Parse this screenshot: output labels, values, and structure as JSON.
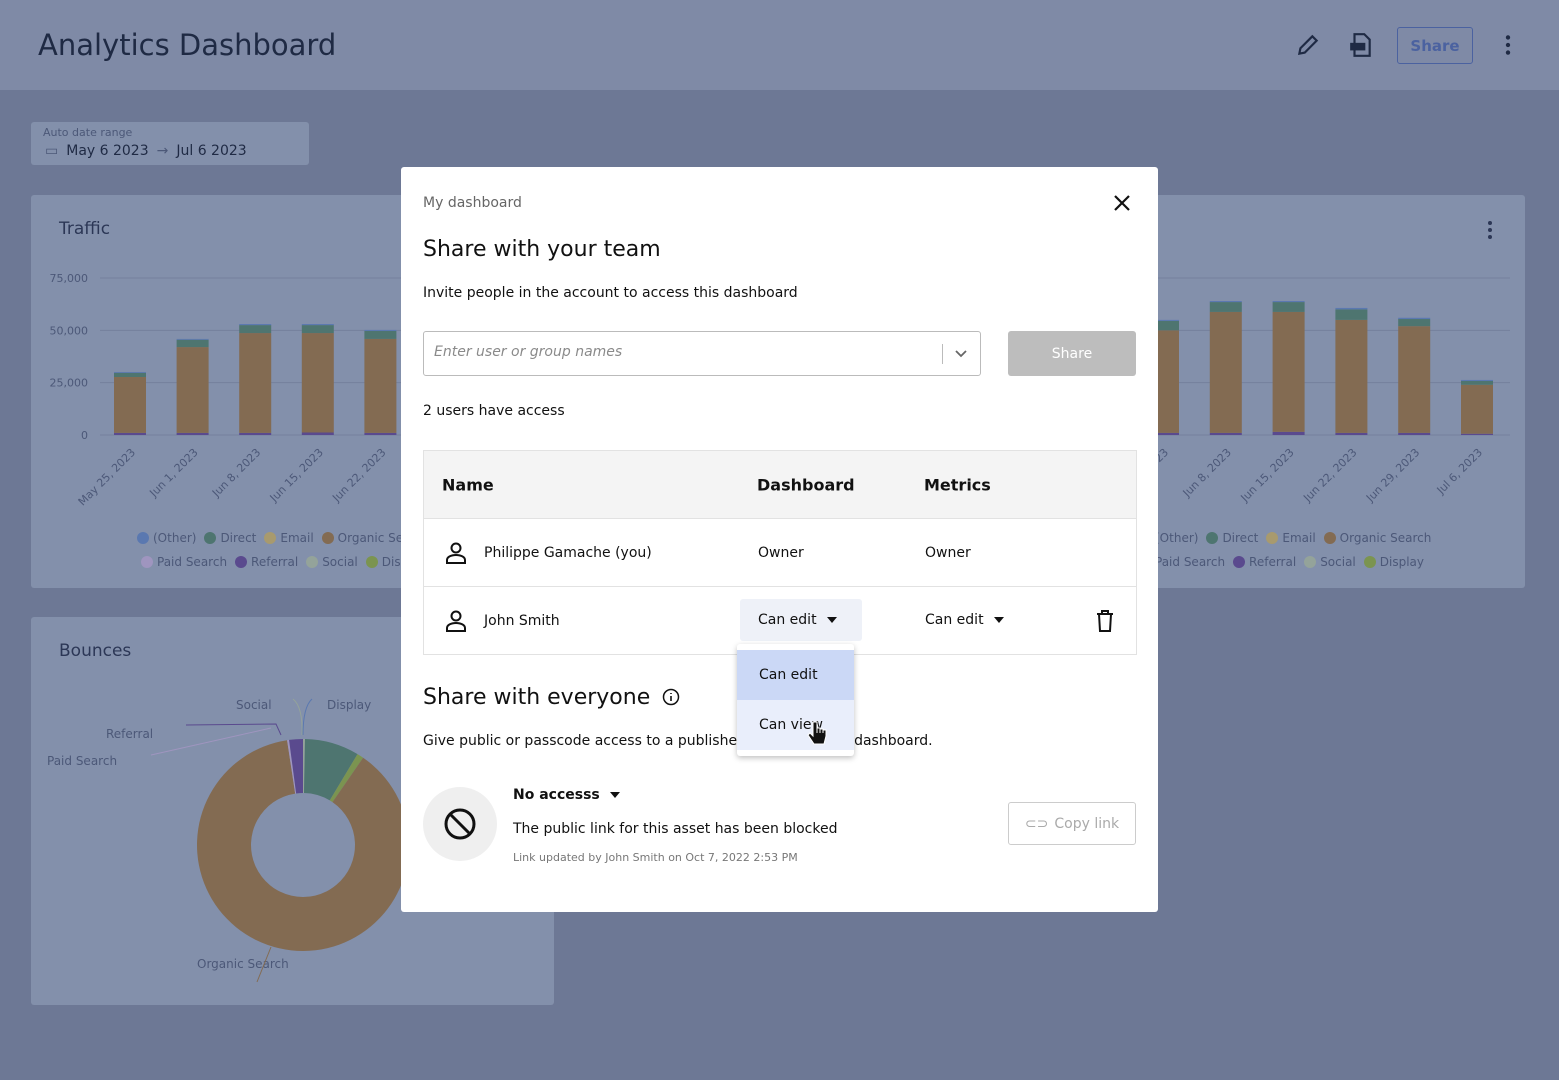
{
  "header": {
    "title": "Analytics Dashboard",
    "share_label": "Share",
    "icons": [
      "pencil-icon",
      "pdf-icon",
      "more-vertical-icon"
    ]
  },
  "date_range": {
    "label": "Auto date range",
    "start": "May 6 2023",
    "end": "Jul 6 2023"
  },
  "traffic": {
    "title": "Traffic",
    "legend_row1": [
      "(Other)",
      "Direct",
      "Email",
      "Organic Search"
    ],
    "legend_row2": [
      "Paid Search",
      "Referral",
      "Social",
      "Display"
    ]
  },
  "bounces": {
    "title": "Bounces"
  },
  "colors": {
    "organic": "#836b52",
    "direct": "#4e7570",
    "referral": "#5a4a8e",
    "other": "#5a78b0",
    "display": "#7b9450",
    "email": "#a89a6e",
    "social": "#94a39a",
    "paid": "#9f95bf",
    "accent": "#4b62a0"
  },
  "chart_data": [
    {
      "type": "bar",
      "stacked": true,
      "title": "Traffic",
      "ylim": [
        0,
        75000
      ],
      "yticks": [
        "0",
        "25,000",
        "50,000",
        "75,000"
      ],
      "grid": true,
      "legend_placement": "bottom",
      "groups": [
        {
          "categories": [
            "May 25, 2023",
            "Jun 1, 2023",
            "Jun 8, 2023",
            "Jun 15, 2023",
            "Jun 22, 2023"
          ],
          "series": [
            {
              "name": "Referral",
              "values": [
                1000,
                1000,
                1000,
                1200,
                1000
              ]
            },
            {
              "name": "Organic Search",
              "values": [
                26700,
                41000,
                47700,
                47500,
                44900
              ]
            },
            {
              "name": "Direct",
              "values": [
                2000,
                3500,
                3800,
                3800,
                3800
              ]
            },
            {
              "name": "(Other)",
              "values": [
                400,
                400,
                500,
                500,
                500
              ]
            }
          ]
        },
        {
          "categories": [
            "2023",
            "Jun 8, 2023",
            "Jun 15, 2023",
            "Jun 22, 2023",
            "Jun 29, 2023",
            "Jul 6, 2023"
          ],
          "series": [
            {
              "name": "Referral",
              "values": [
                1000,
                1000,
                1500,
                1000,
                1000,
                600
              ]
            },
            {
              "name": "Organic Search",
              "values": [
                49000,
                57800,
                57300,
                54000,
                51000,
                23400
              ]
            },
            {
              "name": "Direct",
              "values": [
                4500,
                4700,
                4700,
                5000,
                3400,
                1800
              ]
            },
            {
              "name": "(Other)",
              "values": [
                500,
                500,
                500,
                700,
                600,
                500
              ]
            }
          ]
        }
      ]
    },
    {
      "type": "pie",
      "donut": true,
      "title": "Bounces",
      "slices": [
        {
          "name": "Social",
          "value": 0.3
        },
        {
          "name": "Direct",
          "value": 8.3
        },
        {
          "name": "Display",
          "value": 1.0
        },
        {
          "name": "Organic Search",
          "value": 88.0
        },
        {
          "name": "Paid Search",
          "value": 0.3
        },
        {
          "name": "Referral",
          "value": 2.1
        }
      ],
      "labels": [
        "Social",
        "Display",
        "Referral",
        "Paid Search",
        "Organic Search"
      ]
    }
  ],
  "modal": {
    "breadcrumb": "My dashboard",
    "title": "Share with your team",
    "subtitle": "Invite people in the account to access this dashboard",
    "input_placeholder": "Enter user or group names",
    "share_button": "Share",
    "access_count": "2 users have access",
    "columns": [
      "Name",
      "Dashboard",
      "Metrics"
    ],
    "users": [
      {
        "name": "Philippe Gamache (you)",
        "dashboard": "Owner",
        "metrics": "Owner"
      },
      {
        "name": "John Smith",
        "dashboard": "Can edit",
        "metrics": "Can edit"
      }
    ],
    "dropdown_options": [
      "Can edit",
      "Can view"
    ],
    "everyone_title": "Share with everyone",
    "everyone_desc": "Give public or passcode access to a published version of this dashboard.",
    "access_level": "No accesss",
    "access_status": "The public link for this asset has been blocked",
    "link_updated": "Link updated by John Smith on Oct 7, 2022 2:53 PM",
    "copy_link": "Copy link"
  }
}
